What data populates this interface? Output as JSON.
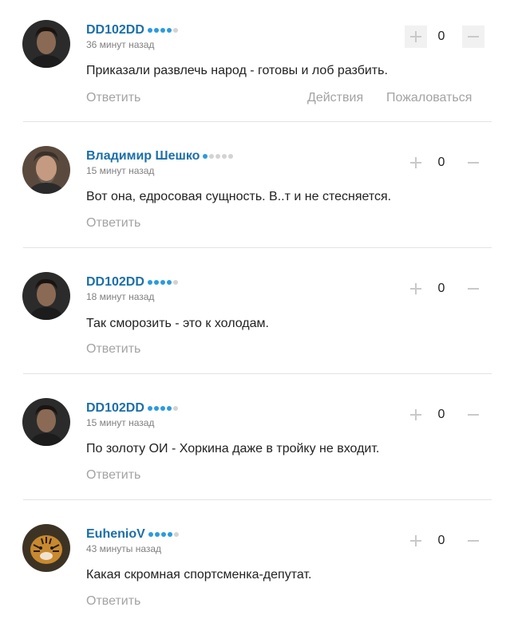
{
  "comments": [
    {
      "author": "DD102DD",
      "rating": 4,
      "time": "36 минут назад",
      "text": "Приказали развлечь народ - готовы и лоб разбить.",
      "reply_label": "Ответить",
      "actions_label": "Действия",
      "report_label": "Пожаловаться",
      "score": "0",
      "avatar": "man-dark-hair"
    },
    {
      "author": "Владимир Шешко",
      "rating": 1,
      "time": "15 минут назад",
      "text": "Вот она, едросовая сущность. В..т и не стесняется.",
      "reply_label": "Ответить",
      "score": "0",
      "avatar": "man-gray-beard"
    },
    {
      "author": "DD102DD",
      "rating": 4,
      "time": "18 минут назад",
      "text": "Так сморозить - это к холодам.",
      "reply_label": "Ответить",
      "score": "0",
      "avatar": "man-dark-hair"
    },
    {
      "author": "DD102DD",
      "rating": 4,
      "time": "15 минут назад",
      "text": "По золоту ОИ - Хоркина даже в тройку не входит.",
      "reply_label": "Ответить",
      "score": "0",
      "avatar": "man-dark-hair"
    },
    {
      "author": "EuhenioV",
      "rating": 4,
      "time": "43 минуты назад",
      "text": "Какая скромная спортсменка-депутат.",
      "reply_label": "Ответить",
      "score": "0",
      "avatar": "tiger"
    }
  ],
  "colors": {
    "dot_on": "#2a9be0",
    "dot_off": "#d3d3d3",
    "name": "#1b6fa8"
  }
}
